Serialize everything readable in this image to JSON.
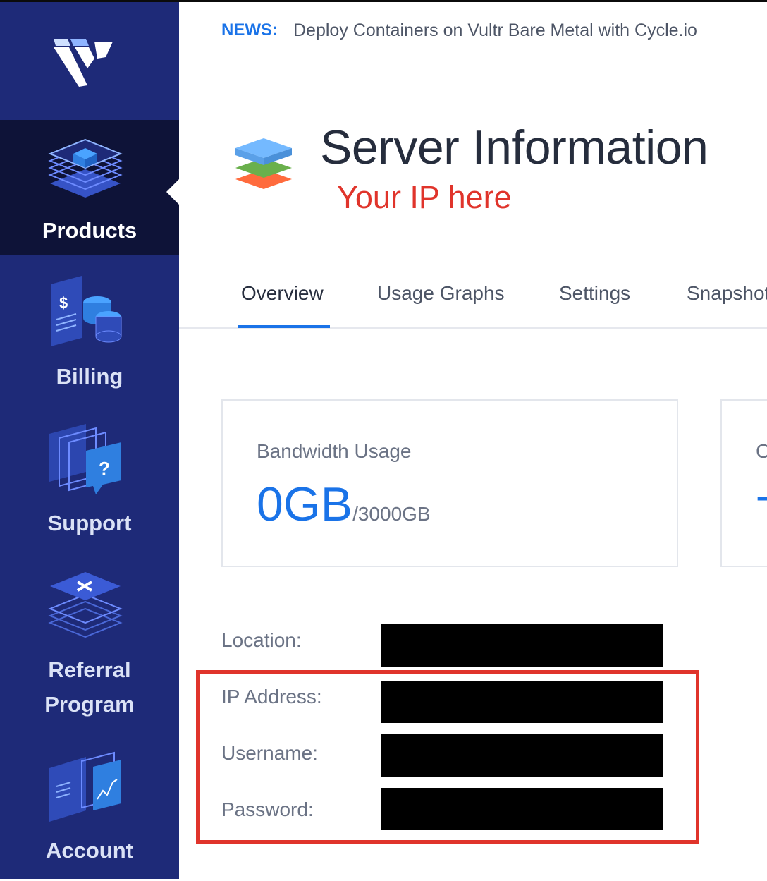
{
  "sidebar": {
    "logo": "vultr-logo",
    "items": [
      {
        "label": "Products",
        "icon": "products-layers-icon",
        "active": true
      },
      {
        "label": "Billing",
        "icon": "billing-icon"
      },
      {
        "label": "Support",
        "icon": "support-icon"
      },
      {
        "label": "Referral Program",
        "label_line1": "Referral",
        "label_line2": "Program",
        "icon": "referral-icon"
      },
      {
        "label": "Account",
        "icon": "account-icon"
      }
    ]
  },
  "news": {
    "tag": "NEWS:",
    "text": "Deploy Containers on Vultr Bare Metal with Cycle.io"
  },
  "page": {
    "title": "Server Information",
    "annotation": "Your IP here",
    "icon": "server-stack-icon"
  },
  "tabs": [
    {
      "label": "Overview",
      "active": true
    },
    {
      "label": "Usage Graphs"
    },
    {
      "label": "Settings"
    },
    {
      "label": "Snapshots"
    }
  ],
  "cards": {
    "bandwidth": {
      "label": "Bandwidth Usage",
      "value": "0GB",
      "limit": "/3000GB"
    },
    "second": {
      "label": "C",
      "value": "-"
    }
  },
  "details": {
    "location_label": "Location:",
    "ip_label": "IP Address:",
    "username_label": "Username:",
    "password_label": "Password:"
  },
  "colors": {
    "sidebar": "#1e2a78",
    "sidebar_active": "#0e1338",
    "accent": "#1a73e8",
    "annotation": "#e0342b"
  }
}
